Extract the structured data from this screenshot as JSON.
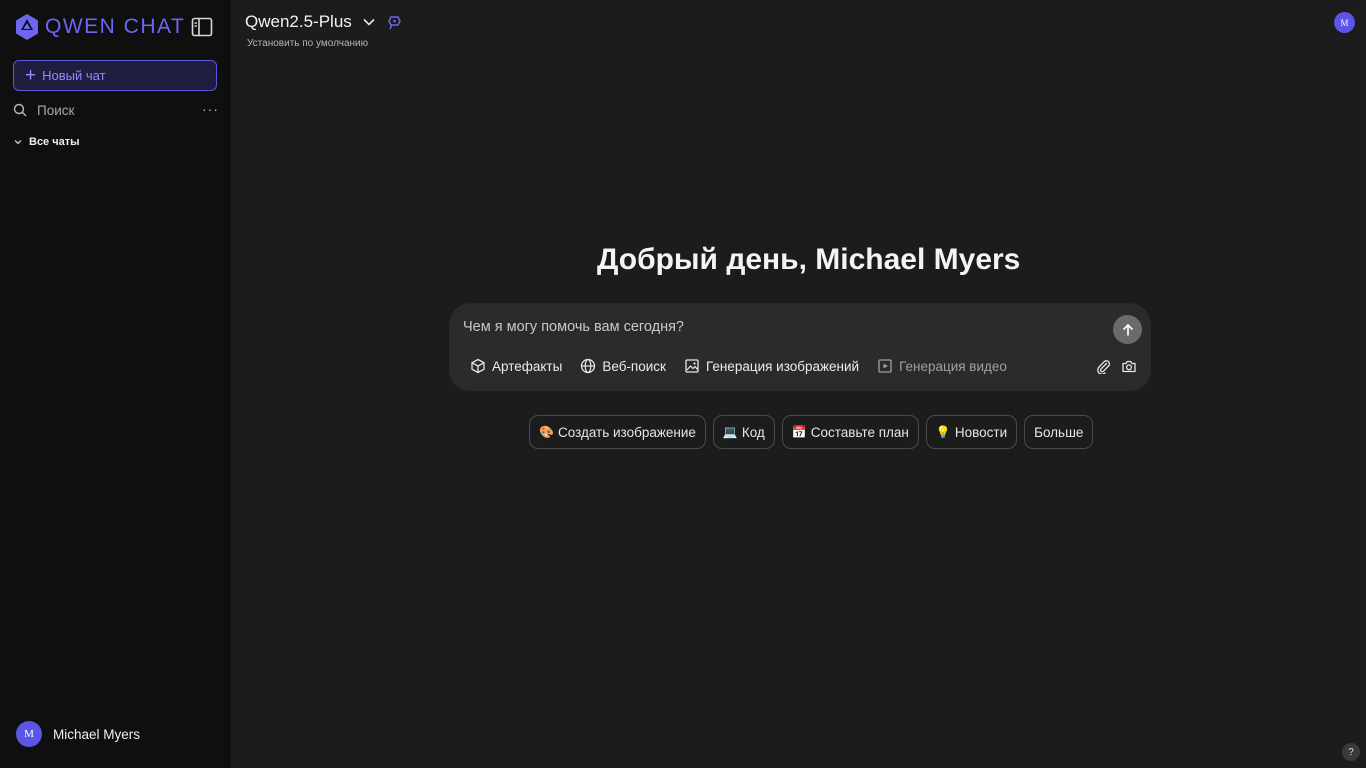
{
  "brand": {
    "name": "QWEN CHAT"
  },
  "sidebar": {
    "new_chat_label": "Новый чат",
    "search_placeholder": "Поиск",
    "more_label": "···",
    "all_chats_label": "Все чаты",
    "user": {
      "name": "Michael Myers",
      "initial": "M"
    }
  },
  "header": {
    "model_name": "Qwen2.5-Plus",
    "set_default_label": "Установить по умолчанию",
    "avatar_initial": "M"
  },
  "main": {
    "greeting": "Добрый день, Michael Myers",
    "composer": {
      "placeholder": "Чем я могу помочь вам сегодня?",
      "tools": [
        {
          "label": "Артефакты",
          "icon": "cube-icon"
        },
        {
          "label": "Веб-поиск",
          "icon": "globe-icon"
        },
        {
          "label": "Генерация изображений",
          "icon": "image-icon"
        },
        {
          "label": "Генерация видео",
          "icon": "video-icon"
        }
      ]
    },
    "suggestions": [
      {
        "emoji": "🎨",
        "label": "Создать изображение"
      },
      {
        "emoji": "💻",
        "label": "Код"
      },
      {
        "emoji": "📅",
        "label": "Составьте план"
      },
      {
        "emoji": "💡",
        "label": "Новости"
      },
      {
        "emoji": "",
        "label": "Больше"
      }
    ],
    "help_label": "?"
  },
  "colors": {
    "accent": "#6c66f0",
    "sidebar_bg": "#0f0f0f",
    "main_bg": "#1c1c1c",
    "composer_bg": "#2b2b2b"
  }
}
